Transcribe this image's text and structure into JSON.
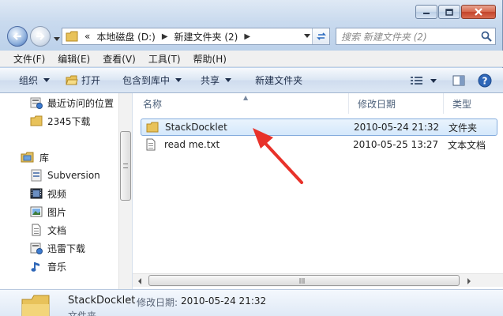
{
  "window": {
    "controls": {
      "minimize": "minimize",
      "maximize": "maximize",
      "close": "close"
    }
  },
  "address": {
    "overflow": "«",
    "crumbs": [
      "本地磁盘 (D:)",
      "新建文件夹 (2)"
    ],
    "search_placeholder": "搜索 新建文件夹 (2)"
  },
  "menu": [
    "文件(F)",
    "编辑(E)",
    "查看(V)",
    "工具(T)",
    "帮助(H)"
  ],
  "toolbar": {
    "organize": "组织",
    "open": "打开",
    "include_in_library": "包含到库中",
    "share": "共享",
    "new_folder": "新建文件夹"
  },
  "sidebar": {
    "favorites": [
      {
        "label": "最近访问的位置",
        "icon": "recent-places-icon"
      },
      {
        "label": "2345下载",
        "icon": "folder-icon"
      }
    ],
    "libraries_label": "库",
    "libraries": [
      {
        "label": "Subversion",
        "icon": "subversion-icon"
      },
      {
        "label": "视频",
        "icon": "video-icon"
      },
      {
        "label": "图片",
        "icon": "picture-icon"
      },
      {
        "label": "文档",
        "icon": "document-icon"
      },
      {
        "label": "迅雷下载",
        "icon": "download-icon"
      },
      {
        "label": "音乐",
        "icon": "music-icon"
      }
    ]
  },
  "columns": {
    "name": "名称",
    "date": "修改日期",
    "type": "类型"
  },
  "files": [
    {
      "name": "StackDocklet",
      "date": "2010-05-24 21:32",
      "type": "文件夹",
      "icon": "folder-icon",
      "selected": true
    },
    {
      "name": "read me.txt",
      "date": "2010-05-25 13:27",
      "type": "文本文档",
      "icon": "text-file-icon",
      "selected": false
    }
  ],
  "details": {
    "name": "StackDocklet",
    "date_label": "修改日期:",
    "date": "2010-05-24 21:32",
    "type": "文件夹"
  },
  "colors": {
    "annotation_arrow": "#e8322a",
    "selection": "#d4e8fb",
    "chrome": "#c9daee"
  }
}
